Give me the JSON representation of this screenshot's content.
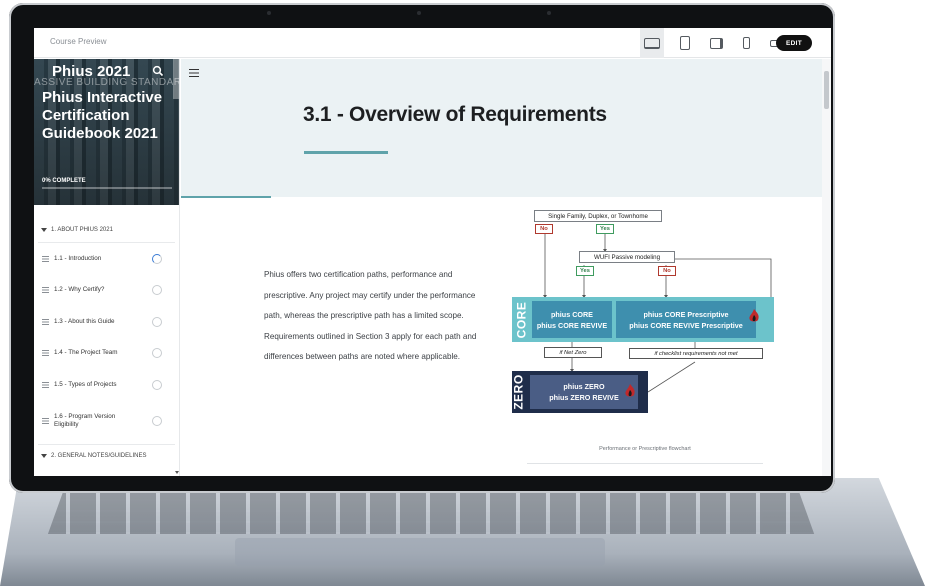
{
  "topbar": {
    "title": "Course Preview",
    "devices": [
      "laptop-icon",
      "tablet-portrait-icon",
      "tablet-landscape-icon",
      "phone-portrait-icon",
      "phone-landscape-icon"
    ],
    "edit_label": "EDIT"
  },
  "sidebar": {
    "hero": {
      "ghost_text": "ASSIVE BUILDING STANDARD",
      "head": "Phius 2021",
      "title": "Phius Interactive Certification Guidebook 2021",
      "progress_label": "0% COMPLETE",
      "progress_fraction": 0
    },
    "sections": [
      {
        "label": "1. ABOUT PHIUS 2021"
      },
      {
        "label": "2. GENERAL NOTES/GUIDELINES"
      }
    ],
    "items": [
      {
        "label": "1.1 - Introduction",
        "status": "in-progress"
      },
      {
        "label": "1.2 - Why Certify?",
        "status": "not-started"
      },
      {
        "label": "1.3 - About this Guide",
        "status": "not-started"
      },
      {
        "label": "1.4 - The Project Team",
        "status": "not-started"
      },
      {
        "label": "1.5 - Types of Projects",
        "status": "not-started"
      },
      {
        "label": "1.6 - Program Version Eligibility",
        "status": "not-started"
      }
    ]
  },
  "main": {
    "page_title": "3.1 - Overview of Requirements",
    "body": "Phius offers two certification paths, performance and prescriptive. Any project may certify under the performance path, whereas the prescriptive path has a limited scope. Requirements outlined in Section 3 apply for each path and differences between paths are noted where applicable.",
    "figure_caption": "Performance or Prescriptive flowchart"
  },
  "flowchart": {
    "start": "Single Family, Duplex, or Townhome",
    "no": "No",
    "yes": "Yes",
    "wufi": "WUFI Passive modeling",
    "core_label": "CORE",
    "core_perf_1": "phius CORE",
    "core_perf_2": "phius CORE REVIVE",
    "core_presc_1": "phius CORE Prescriptive",
    "core_presc_2": "phius CORE REVIVE Prescriptive",
    "if_net_zero": "if Net Zero",
    "if_checklist": "if checklist requirements not met",
    "zero_label": "ZERO",
    "zero_1": "phius ZERO",
    "zero_2": "phius ZERO REVIVE"
  },
  "colors": {
    "accent": "#5fa3aa",
    "banner_bg": "#ebf2f4",
    "core_band": "#6cc3cb",
    "core_box": "#3e8fae",
    "zero_band": "#1f2d4a",
    "zero_box": "#4a5d85",
    "no_tag": "#b0392e",
    "yes_tag": "#3f9b5f"
  }
}
